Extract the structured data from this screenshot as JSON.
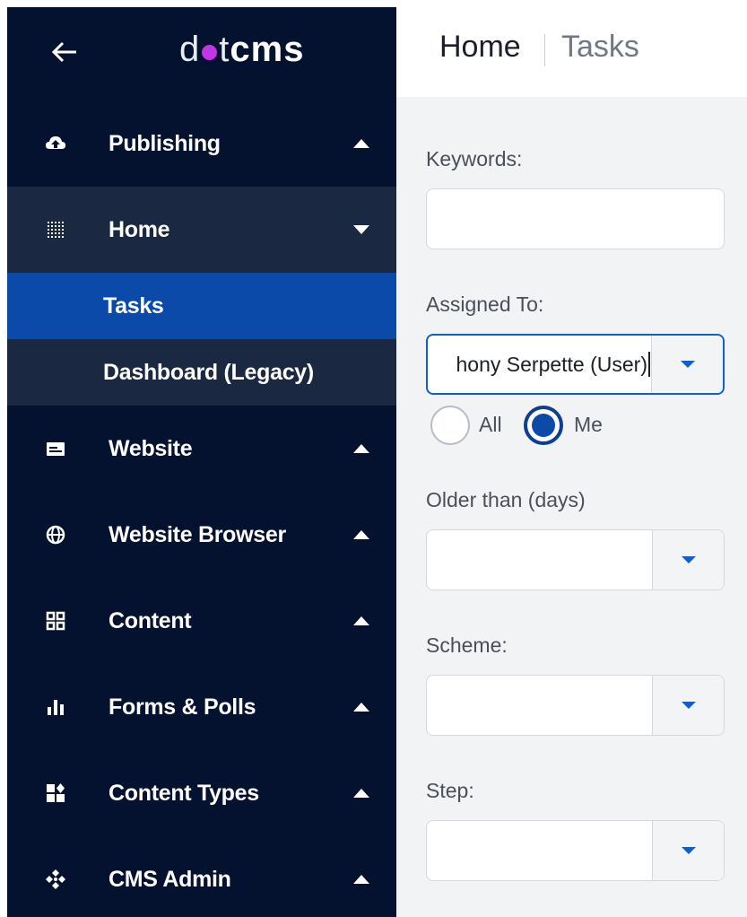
{
  "brand": {
    "logo_part1": "d",
    "logo_part2": "t",
    "logo_part3": "cms",
    "dot_color": "#c336e5"
  },
  "sidebar": {
    "back_icon": "arrow-left-icon",
    "items": [
      {
        "label": "Publishing",
        "icon": "cloud-upload-icon",
        "state": "collapsed"
      },
      {
        "label": "Home",
        "icon": "grid-dots-icon",
        "state": "expanded"
      },
      {
        "label": "Website",
        "icon": "browser-window-icon",
        "state": "collapsed"
      },
      {
        "label": "Website Browser",
        "icon": "globe-icon",
        "state": "collapsed"
      },
      {
        "label": "Content",
        "icon": "grid-squares-icon",
        "state": "collapsed"
      },
      {
        "label": "Forms & Polls",
        "icon": "bar-chart-icon",
        "state": "collapsed"
      },
      {
        "label": "Content Types",
        "icon": "content-types-icon",
        "state": "collapsed"
      },
      {
        "label": "CMS Admin",
        "icon": "diamond-arrows-icon",
        "state": "collapsed"
      }
    ],
    "home_subitems": [
      {
        "label": "Tasks",
        "active": true
      },
      {
        "label": "Dashboard (Legacy)",
        "active": false
      }
    ],
    "colors": {
      "background": "#04122f",
      "expanded": "#1b2841",
      "active": "#0b4aa8"
    }
  },
  "header": {
    "breadcrumb_home": "Home",
    "breadcrumb_current": "Tasks"
  },
  "form": {
    "keywords_label": "Keywords:",
    "keywords_value": "",
    "assigned_label": "Assigned To:",
    "assigned_value": "hony Serpette (User)",
    "radio_all_label": "All",
    "radio_me_label": "Me",
    "radio_selected": "Me",
    "older_label": "Older than (days)",
    "older_value": "",
    "scheme_label": "Scheme:",
    "scheme_value": "",
    "step_label": "Step:",
    "step_value": "",
    "accent_color": "#1060c8"
  }
}
